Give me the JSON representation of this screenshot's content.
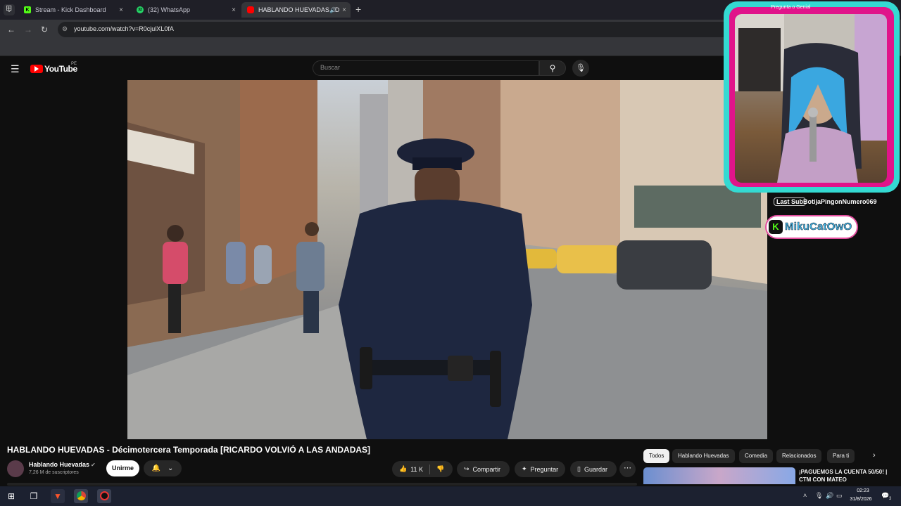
{
  "browser": {
    "tabs": [
      {
        "title": "Stream - Kick Dashboard",
        "favicon_color": "#53fc18",
        "favicon_letter": "K",
        "active": false
      },
      {
        "title": "(32) WhatsApp",
        "favicon_color": "#25d366",
        "favicon_letter": "32",
        "active": false
      },
      {
        "title": "HABLANDO HUEVADAS - D",
        "favicon_color": "#ff0000",
        "favicon_letter": "",
        "active": true
      }
    ],
    "url": "youtube.com/watch?v=R0cjulXL0fA",
    "new_tab": "+",
    "close": "×"
  },
  "youtube": {
    "logo_text": "YouTube",
    "country_code": "PE",
    "search_placeholder": "Buscar",
    "video_title": "HABLANDO HUEVADAS - Décimotercera Temporada [RICARDO VOLVIÓ A LAS ANDADAS]",
    "channel": {
      "name": "Hablando Huevadas",
      "subscribers": "7,26 M de suscriptores"
    },
    "join_label": "Unirme",
    "likes": "11 K",
    "share_label": "Compartir",
    "ask_label": "Preguntar",
    "save_label": "Guardar",
    "chips": [
      {
        "label": "Todos",
        "active": true
      },
      {
        "label": "Hablando Huevadas",
        "active": false
      },
      {
        "label": "Comedia",
        "active": false
      },
      {
        "label": "Relacionados",
        "active": false
      },
      {
        "label": "Para ti",
        "active": false
      }
    ],
    "recommended": {
      "title_line1": "¡PAGUEMOS LA CUENTA 50/50! |",
      "title_line2": "CTM CON MATEO"
    }
  },
  "stream_overlay": {
    "caption": "Pregunta o Genial",
    "last_sub_label": "Last Sub",
    "last_sub_user": "BotijaPingonNumero069",
    "kick_username": "MikuCatOwO",
    "frame_color": "#34d9d2",
    "accent_color": "#e0148a"
  },
  "taskbar": {
    "time": "02:23",
    "date": "31/8/2026",
    "notification_count": "3"
  },
  "colors": {
    "youtube_red": "#ff0000",
    "kick_green": "#53fc18",
    "background": "#0f0f0f"
  }
}
